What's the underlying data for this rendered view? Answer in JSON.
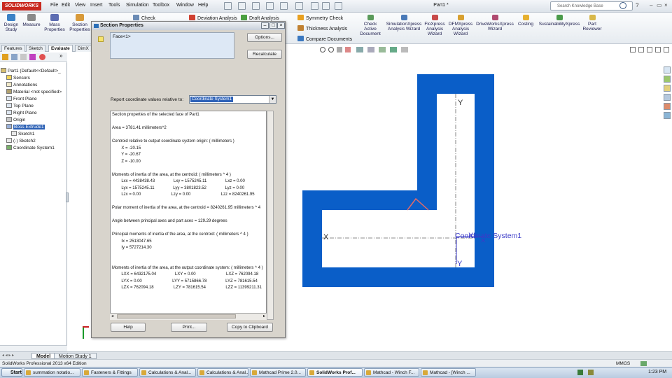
{
  "app": {
    "logo": "SOLIDWORKS",
    "menus": [
      "File",
      "Edit",
      "View",
      "Insert",
      "Tools",
      "Simulation",
      "Toolbox",
      "Window",
      "Help"
    ],
    "doc_title": "Part1 *",
    "search_placeholder": "Search Knowledge Base"
  },
  "ribbon": {
    "big_buttons": [
      {
        "label": "Design\nStudy",
        "icon": "design-study-icon"
      },
      {
        "label": "Measure",
        "icon": "measure-icon"
      },
      {
        "label": "Mass\nProperties",
        "icon": "mass-properties-icon"
      },
      {
        "label": "Section\nProperties",
        "icon": "section-properties-icon"
      }
    ],
    "small_buttons": [
      "Check",
      "Deviation Analysis",
      "Draft Analysis",
      "Symmetry Check",
      "Thickness Analysis",
      "Compare Documents"
    ],
    "right_buttons": [
      {
        "label": "Check\nActive\nDocument",
        "icon": "check-doc-icon"
      },
      {
        "label": "SimulationXpress\nAnalysis Wizard",
        "icon": "simulation-icon"
      },
      {
        "label": "FloXpress\nAnalysis\nWizard",
        "icon": "floxpress-icon"
      },
      {
        "label": "DFMXpress\nAnalysis\nWizard",
        "icon": "dfmxpress-icon"
      },
      {
        "label": "DriveWorksXpress\nWizard",
        "icon": "driveworks-icon"
      },
      {
        "label": "Costing",
        "icon": "costing-icon"
      },
      {
        "label": "SustainabilityXpress",
        "icon": "sustainability-icon"
      },
      {
        "label": "Part\nReviewer",
        "icon": "part-reviewer-icon"
      }
    ]
  },
  "panel": {
    "tabs": [
      "Features",
      "Sketch",
      "Evaluate",
      "DimX"
    ],
    "active_tab": "Evaluate",
    "tree": [
      {
        "label": "Part1  (Default<<Default>_",
        "depth": 0
      },
      {
        "label": "Sensors",
        "depth": 1
      },
      {
        "label": "Annotations",
        "depth": 1
      },
      {
        "label": "Material <not specified>",
        "depth": 1
      },
      {
        "label": "Front Plane",
        "depth": 1
      },
      {
        "label": "Top Plane",
        "depth": 1
      },
      {
        "label": "Right Plane",
        "depth": 1
      },
      {
        "label": "Origin",
        "depth": 1
      },
      {
        "label": "Boss-Extrude1",
        "depth": 1,
        "selected": true
      },
      {
        "label": "Sketch1",
        "depth": 2
      },
      {
        "label": "(-) Sketch2",
        "depth": 1
      },
      {
        "label": "Coordinate System1",
        "depth": 1
      }
    ]
  },
  "dialog": {
    "title": "Section Properties",
    "face_item": "Face<1>",
    "options_label": "Options...",
    "recalc_label": "Recalculate",
    "report_label": "Report coordinate values relative to:",
    "coord_system": "Coordinate System1",
    "results": [
      "Section properties of the selected face of Part1",
      "",
      "Area = 3781.41 millimeters^2",
      "",
      "Centroid relative to output coordinate system origin: ( millimeters )",
      "        X = -20.15",
      "        Y = -20.67",
      "        Z = -10.00",
      "",
      "Moments of inertia of the area, at the centroid: ( millimeters ^ 4 )",
      "        Lxx = 4438438.43                Lxy = 1575245.11                Lxz = 0.00",
      "        Lyx = 1575245.11                Lyy = 3801823.52                Lyz = 0.00",
      "        Lzx = 0.00                          Lzy = 0.00                          Lzz = 8240261.95",
      "",
      "Polar moment of inertia of the area, at the centroid = 8240261.95 millimeters ^ 4",
      "",
      "Angle between principal axes and part axes = 129.29 degrees",
      "",
      "Principal moments of inertia of the area, at the centroid: ( millimeters ^ 4 )",
      "        Ix = 2513047.65",
      "        Iy = 5727214.30",
      "",
      "",
      "Moments of inertia of the area, at the output coordinate system: ( millimeters ^ 4 )",
      "        LXX = 6432175.04                LXY = 0.00                          LXZ = 762094.18",
      "        LYX = 0.00                          LYY = 5715866.78                LYZ = 781615.54",
      "        LZX = 762094.18                 LZY = 781615.54                 LZZ = 11399211.31"
    ],
    "help_label": "Help",
    "print_label": "Print...",
    "copy_label": "Copy to Clipboard"
  },
  "viewport": {
    "axis_x_left": "X",
    "axis_y_top": "Y",
    "axis_x_csys": "X",
    "axis_y_csys": "Y",
    "csys_label": "Coordinate System1",
    "colors": {
      "part": "#0a5ec8",
      "face_inner": "#ffffff",
      "axis": "#666666",
      "csys": "#3b3bc8"
    }
  },
  "model_tabs": [
    "Model",
    "Motion Study 1"
  ],
  "status": {
    "left": "SolidWorks Professional 2013 x64 Edition",
    "units": "MMGS"
  },
  "taskbar": {
    "start": "Start",
    "items": [
      "summation notatio...",
      "Fasteners & Fittings",
      "Calculations & Anal...",
      "Calculations & Anal...",
      "Mathcad Prime 2.0...",
      "SolidWorks Prof...",
      "Mathcad - Winch F...",
      "Mathcad - [Winch ..."
    ],
    "active_index": 5,
    "clock": "1:23 PM"
  }
}
